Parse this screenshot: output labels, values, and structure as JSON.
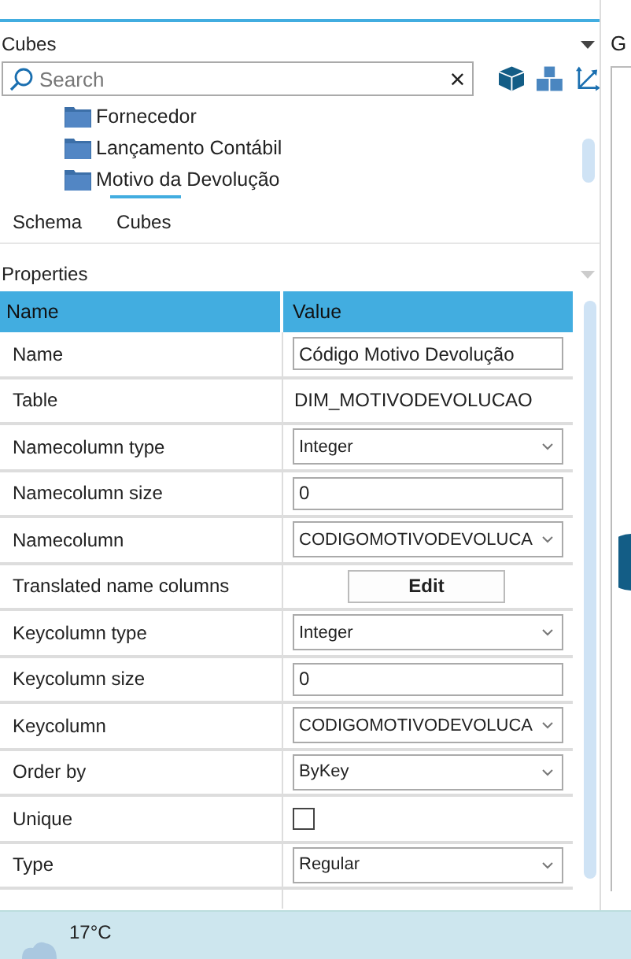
{
  "cubes_panel": {
    "title": "Cubes",
    "search": {
      "placeholder": "Search",
      "clear": "×"
    },
    "tree": [
      {
        "label": "Fornecedor"
      },
      {
        "label": "Lançamento Contábil"
      },
      {
        "label": "Motivo da Devolução"
      }
    ],
    "tabs": [
      {
        "label": "Schema",
        "selected": false
      },
      {
        "label": "Cubes",
        "selected": true
      }
    ]
  },
  "properties_panel": {
    "title": "Properties",
    "columns": [
      "Name",
      "Value"
    ],
    "rows": [
      {
        "name": "Name",
        "kind": "input",
        "value": "Código Motivo Devolução"
      },
      {
        "name": "Table",
        "kind": "text",
        "value": "DIM_MOTIVODEVOLUCAO"
      },
      {
        "name": "Namecolumn type",
        "kind": "select",
        "value": "Integer"
      },
      {
        "name": "Namecolumn size",
        "kind": "input",
        "value": "0"
      },
      {
        "name": "Namecolumn",
        "kind": "select",
        "value": "CODIGOMOTIVODEVOLUCA"
      },
      {
        "name": "Translated name columns",
        "kind": "button",
        "value": "Edit"
      },
      {
        "name": "Keycolumn type",
        "kind": "select",
        "value": "Integer"
      },
      {
        "name": "Keycolumn size",
        "kind": "input",
        "value": "0"
      },
      {
        "name": "Keycolumn",
        "kind": "select",
        "value": "CODIGOMOTIVODEVOLUCA"
      },
      {
        "name": "Order by",
        "kind": "select",
        "value": "ByKey"
      },
      {
        "name": "Unique",
        "kind": "checkbox",
        "checked": false
      },
      {
        "name": "Type",
        "kind": "select",
        "value": "Regular"
      }
    ]
  },
  "right_panel": {
    "tab": "G"
  },
  "taskbar": {
    "temperature": "17°C"
  }
}
